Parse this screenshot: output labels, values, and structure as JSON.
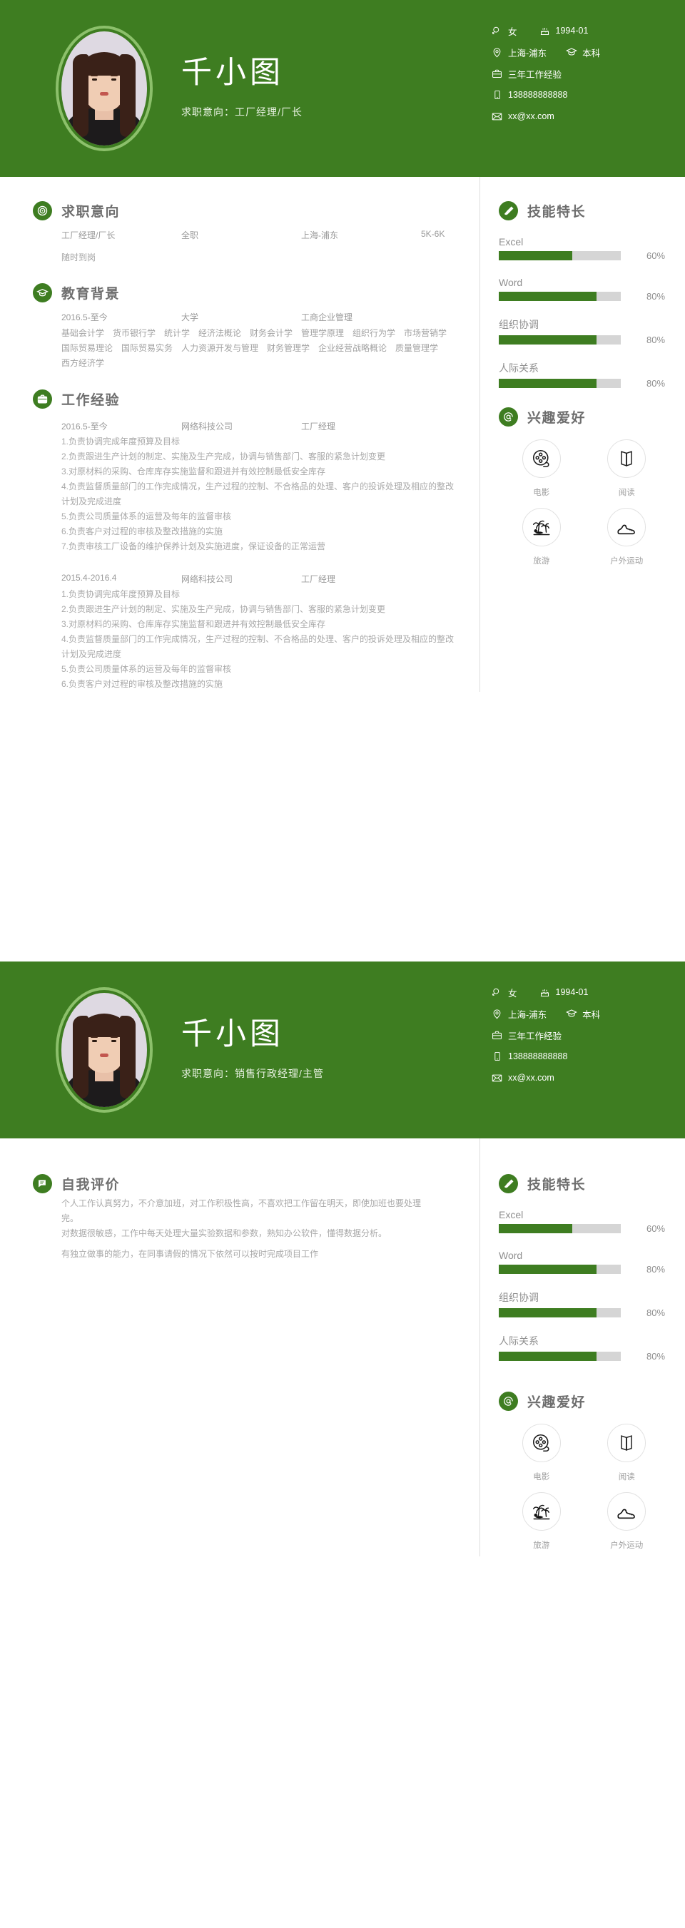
{
  "theme": {
    "green": "#3e7d21",
    "avatar_ring": "#8cc06b",
    "bar_track": "#d5d5d5",
    "text_gray": "#a9a9a9",
    "heading_gray": "#6e6e6e"
  },
  "person": {
    "name": "千小图",
    "intent_label_page1": "求职意向：工厂经理/厂长",
    "intent_label_page2": "求职意向：销售行政经理/主管"
  },
  "contact": {
    "gender": "女",
    "birth": "1994-01",
    "location": "上海-浦东",
    "education": "本科",
    "experience": "三年工作经验",
    "phone": "138888888888",
    "email": "xx@xx.com",
    "icons": {
      "gender": "gender-icon",
      "birth": "birthday-cake-icon",
      "location": "map-pin-icon",
      "education": "graduation-cap-icon",
      "experience": "briefcase-icon",
      "phone": "mobile-phone-icon",
      "email": "envelope-icon"
    }
  },
  "sections": {
    "job_intention": {
      "title": "求职意向",
      "icon": "target-icon",
      "position": "工厂经理/厂长",
      "type": "全职",
      "city": "上海-浦东",
      "salary": "5K-6K",
      "availability": "随时到岗"
    },
    "education": {
      "title": "教育背景",
      "icon": "graduation-cap-icon",
      "period": "2016.5-至今",
      "school": "大学",
      "major": "工商企业管理",
      "courses": "基础会计学　货币银行学　统计学　经济法概论　财务会计学　管理学原理　组织行为学　市场营销学　国际贸易理论　国际贸易实务　人力资源开发与管理　财务管理学　企业经营战略概论　质量管理学　西方经济学"
    },
    "work": {
      "title": "工作经验",
      "icon": "briefcase-icon",
      "jobs": [
        {
          "period": "2016.5-至今",
          "company": "网络科技公司",
          "role": "工厂经理",
          "bullets": [
            "1.负责协调完成年度预算及目标",
            "2.负责跟进生产计划的制定、实施及生产完成，协调与销售部门、客服的紧急计划变更",
            "3.对原材料的采购、仓库库存实施监督和跟进并有效控制最低安全库存",
            "4.负责监督质量部门的工作完成情况，生产过程的控制、不合格品的处理、客户的投诉处理及相应的整改计划及完成进度",
            "5.负责公司质量体系的运营及每年的监督审核",
            "6.负责客户对过程的审核及整改措施的实施",
            "7.负责审核工厂设备的维护保养计划及实施进度，保证设备的正常运营"
          ]
        },
        {
          "period": "2015.4-2016.4",
          "company": "网络科技公司",
          "role": "工厂经理",
          "bullets": [
            "1.负责协调完成年度预算及目标",
            "2.负责跟进生产计划的制定、实施及生产完成，协调与销售部门、客服的紧急计划变更",
            "3.对原材料的采购、仓库库存实施监督和跟进并有效控制最低安全库存",
            "4.负责监督质量部门的工作完成情况，生产过程的控制、不合格品的处理、客户的投诉处理及相应的整改计划及完成进度",
            "5.负责公司质量体系的运营及每年的监督审核",
            "6.负责客户对过程的审核及整改措施的实施"
          ]
        }
      ]
    },
    "self_eval": {
      "title": "自我评价",
      "icon": "speech-bubble-icon",
      "paragraphs": [
        "个人工作认真努力，不介意加班，对工作积极性高，不喜欢把工作留在明天，即使加班也要处理完。",
        "对数据很敏感，工作中每天处理大量实验数据和参数，熟知办公软件，懂得数据分析。",
        "有独立做事的能力，在同事请假的情况下依然可以按时完成项目工作"
      ]
    },
    "skills": {
      "title": "技能特长",
      "icon": "paintbrush-icon",
      "items": [
        {
          "name": "Excel",
          "percent": "60%",
          "value": 60
        },
        {
          "name": "Word",
          "percent": "80%",
          "value": 80
        },
        {
          "name": "组织协调",
          "percent": "80%",
          "value": 80
        },
        {
          "name": "人际关系",
          "percent": "80%",
          "value": 80
        }
      ]
    },
    "hobbies": {
      "title": "兴趣爱好",
      "icon": "at-circle-icon",
      "items": [
        {
          "label": "电影",
          "icon": "film-reel-icon"
        },
        {
          "label": "阅读",
          "icon": "open-book-icon"
        },
        {
          "label": "旅游",
          "icon": "palm-tree-icon"
        },
        {
          "label": "户外运动",
          "icon": "hiking-boot-icon"
        }
      ]
    }
  }
}
